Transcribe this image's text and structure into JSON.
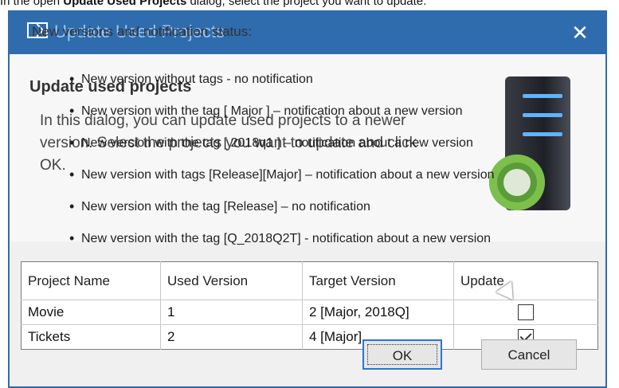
{
  "doc": {
    "instruction_prefix": "In the open ",
    "instruction_bold": "Update Used Projects",
    "instruction_suffix": " dialog, select the project you want to update."
  },
  "dialog": {
    "title": "Update Used Projects",
    "close_label": "✕",
    "header": {
      "heading": "Update used projects",
      "description": "In this dialog, you can update used projects to a newer version. Select the projects you want to update and click OK."
    },
    "table": {
      "columns": [
        "Project Name",
        "Used Version",
        "Target Version",
        "Update"
      ],
      "rows": [
        {
          "name": "Movie",
          "used": "1",
          "target": "2 [Major, 2018Q]",
          "checked": false
        },
        {
          "name": "Tickets",
          "used": "2",
          "target": "4 [Major]",
          "checked": true
        }
      ]
    },
    "buttons": {
      "ok": "OK",
      "cancel": "Cancel"
    }
  },
  "notes": {
    "title": "New versions and notification status:",
    "items": [
      "New version without tags - no notification",
      "New version with the tag [ Major ] – notification about a new version",
      "New version with the tag [ 2018q1 ] – notification about a new version",
      "New version with tags [Release][Major] – notification about a new version",
      "New version with the tag [Release] – no notification",
      "New version with the tag [Q_2018Q2T] - notification about a new version"
    ]
  },
  "icons": {
    "title": "dialog-update-icon",
    "header": "server-update-icon",
    "close": "close-icon"
  }
}
